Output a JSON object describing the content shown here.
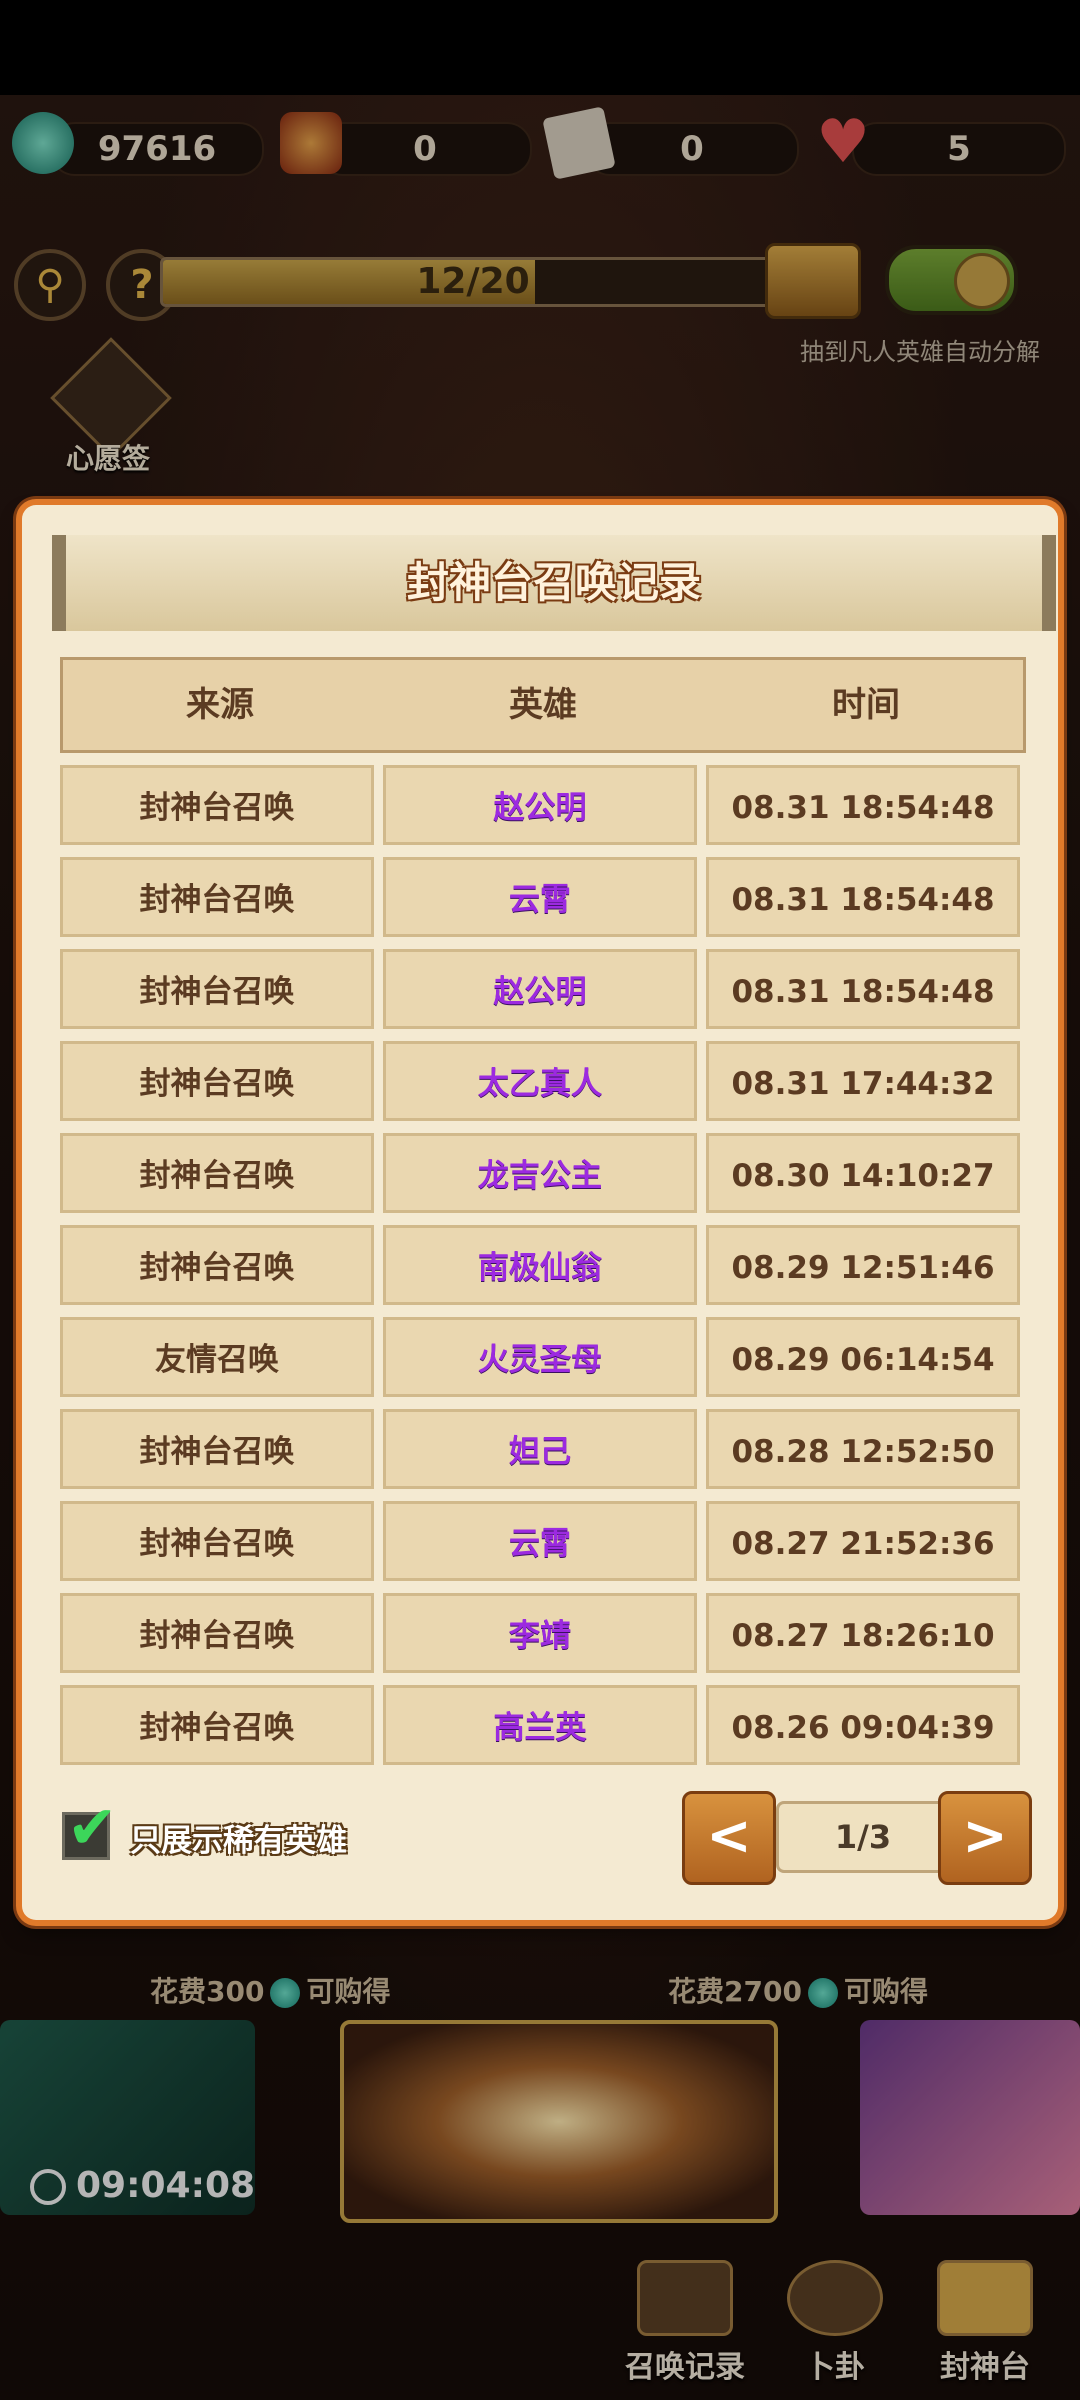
{
  "resources": [
    {
      "icon": "jade-coin-icon",
      "value": "97616"
    },
    {
      "icon": "treasure-icon",
      "value": "0"
    },
    {
      "icon": "scroll-ticket-icon",
      "value": "0"
    },
    {
      "icon": "heart-icon",
      "value": "5"
    }
  ],
  "summon_progress": {
    "text": "12/20",
    "fraction": 0.6
  },
  "auto_decompose_label": "抽到凡人英雄自动分解",
  "wish_label": "心愿签",
  "dialog": {
    "title": "封神台召唤记录",
    "columns": [
      "来源",
      "英雄",
      "时间"
    ],
    "rows": [
      {
        "source": "封神台召唤",
        "hero": "赵公明",
        "time": "08.31 18:54:48"
      },
      {
        "source": "封神台召唤",
        "hero": "云霄",
        "time": "08.31 18:54:48"
      },
      {
        "source": "封神台召唤",
        "hero": "赵公明",
        "time": "08.31 18:54:48"
      },
      {
        "source": "封神台召唤",
        "hero": "太乙真人",
        "time": "08.31 17:44:32"
      },
      {
        "source": "封神台召唤",
        "hero": "龙吉公主",
        "time": "08.30 14:10:27"
      },
      {
        "source": "封神台召唤",
        "hero": "南极仙翁",
        "time": "08.29 12:51:46"
      },
      {
        "source": "友情召唤",
        "hero": "火灵圣母",
        "time": "08.29 06:14:54"
      },
      {
        "source": "封神台召唤",
        "hero": "妲己",
        "time": "08.28 12:52:50"
      },
      {
        "source": "封神台召唤",
        "hero": "云霄",
        "time": "08.27 21:52:36"
      },
      {
        "source": "封神台召唤",
        "hero": "李靖",
        "time": "08.27 18:26:10"
      },
      {
        "source": "封神台召唤",
        "hero": "高兰英",
        "time": "08.26 09:04:39"
      }
    ],
    "rare_only_label": "只展示稀有英雄",
    "rare_only_checked": true,
    "pager": {
      "prev": "<",
      "page": "1/3",
      "next": ">"
    }
  },
  "bottom": {
    "cost_left": {
      "prefix": "花费300",
      "suffix": "可购得"
    },
    "cost_right": {
      "prefix": "花费2700",
      "suffix": "可购得"
    },
    "timer": "09:04:08",
    "nav": [
      "召唤记录",
      "卜卦",
      "封神台"
    ]
  },
  "colors": {
    "hero_purple": "#9c2ae0",
    "dialog_border": "#e07a2a",
    "panel": "#f4ead2"
  }
}
